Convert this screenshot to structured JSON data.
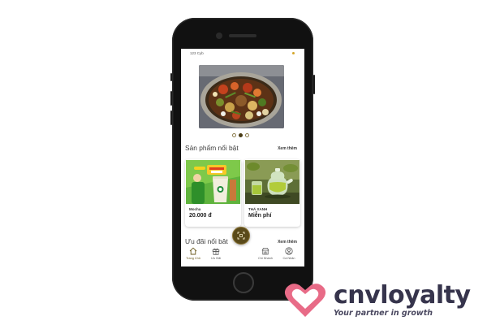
{
  "status_bar": {
    "text": "123 Cyb"
  },
  "banner": {
    "image": "hotpot-photo",
    "active_slide": 2,
    "slide_count": 3
  },
  "featured": {
    "title": "Sản phẩm nổi bật",
    "see_more": "Xem thêm",
    "products": [
      {
        "name": "Mocha",
        "price": "20.000 đ",
        "image": "mocha-promo-photo"
      },
      {
        "name": "THÁ XANH",
        "price": "Miễn phí",
        "image": "green-tea-photo"
      }
    ]
  },
  "offers": {
    "title": "Ưu đãi nổi bật",
    "see_more": "Xem thêm"
  },
  "tabs": [
    {
      "label": "Trang Chủ",
      "icon": "home-icon",
      "active": true
    },
    {
      "label": "Ưu Đãi",
      "icon": "gift-icon",
      "active": false
    },
    {
      "label": "Chi Nhánh",
      "icon": "store-icon",
      "active": false
    },
    {
      "label": "Cá Nhân",
      "icon": "user-icon",
      "active": false
    }
  ],
  "scan_button": {
    "icon": "scan-icon"
  },
  "logo": {
    "brand": "cnvloyalty",
    "tagline": "Your partner in growth"
  },
  "colors": {
    "accent": "#5a4a1a",
    "logo_pink": "#e86b87",
    "logo_text": "#36344c"
  }
}
